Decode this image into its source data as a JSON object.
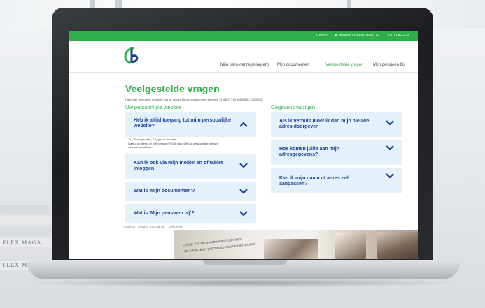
{
  "topbar": {
    "contact": "Contact",
    "user": "Welkom O'MANCDWKOFO",
    "logout": "UITLOGGEN"
  },
  "logo": {
    "icon": "gb-logo-icon",
    "color": "#2eaf4a"
  },
  "nav": {
    "items": [
      "Mijn pensioenregeling(en)",
      "Mijn documenten",
      "Veelgestelde vragen",
      "Mijn pensioen bij"
    ],
    "active_index": 2
  },
  "page": {
    "title": "Veelgestelde vragen",
    "intro": "Hieronder met u een overzicht van de vragen bij uw pensioen met kenmerk 31-44517718-50450656-19600931."
  },
  "left_column": {
    "heading": "Uw persoonlijke website",
    "items": [
      {
        "question": "Heb ik altijd toegang tot mijn persoonlijke website?",
        "expanded": true,
        "answer_line1": "Ja, 24 uur per dag, 7 dagen in de week.",
        "answer_line2": "Gaat u uit dienst of met pensioen? Ook dan blijft uw persoonlijke website",
        "answer_line3": "voor u beschikbaar."
      },
      {
        "question": "Kan ik ook via mijn mobiel en of tablet inloggen"
      },
      {
        "question": "Wat is 'Mijn documenten'?"
      },
      {
        "question": "Wat is 'Mijn pensioen bij'?"
      }
    ]
  },
  "right_column": {
    "heading": "Gegevens wijzigen",
    "items": [
      {
        "question": "Als ik verhuis moet ik dan mijn nieuwe adres doorgeven"
      },
      {
        "question": "Hoe komen jullie aan mijn adresgegevens?"
      },
      {
        "question": "Kan ik mijn naam of adres zelf aanpassen?"
      }
    ]
  },
  "footer": {
    "links": [
      "Cookies",
      "Privacy",
      "Disclaimer",
      "Veiligheid"
    ]
  },
  "photo_text": {
    "line1": "Let op: het zijn voorbeelden! Uiteraard",
    "line2": "die we in deze geschetste situatie niet hebben."
  },
  "books": [
    "FLEX MAGA",
    "FLEX MAGAZ"
  ],
  "colors": {
    "brand_green": "#2eaf4a",
    "question_blue": "#1c3f94",
    "card_bg": "#e4f1fb"
  }
}
